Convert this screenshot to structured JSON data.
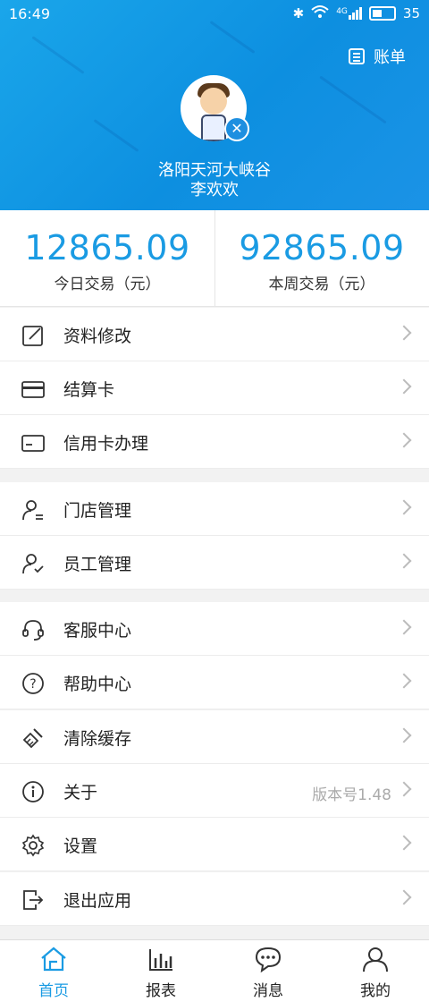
{
  "status_bar": {
    "time": "16:49",
    "network": "4G",
    "battery": "35"
  },
  "header": {
    "bill_label": "账单",
    "store_name": "洛阳天河大峡谷",
    "user_name": "李欢欢"
  },
  "stats": {
    "today": {
      "value": "12865.09",
      "label": "今日交易（元）"
    },
    "week": {
      "value": "92865.09",
      "label": "本周交易（元）"
    }
  },
  "menu": {
    "profile": {
      "label": "资料修改",
      "icon": "edit-icon"
    },
    "settlement_card": {
      "label": "结算卡",
      "icon": "card-icon"
    },
    "credit_card": {
      "label": "信用卡办理",
      "icon": "credit-card-icon"
    },
    "store_manage": {
      "label": "门店管理",
      "icon": "store-user-icon"
    },
    "staff_manage": {
      "label": "员工管理",
      "icon": "staff-user-icon"
    },
    "customer_service": {
      "label": "客服中心",
      "icon": "headset-icon"
    },
    "help": {
      "label": "帮助中心",
      "icon": "question-icon"
    },
    "clear_cache": {
      "label": "清除缓存",
      "icon": "broom-icon"
    },
    "about": {
      "label": "关于",
      "icon": "info-icon",
      "value": "版本号1.48"
    },
    "settings": {
      "label": "设置",
      "icon": "gear-icon"
    },
    "logout": {
      "label": "退出应用",
      "icon": "exit-icon"
    }
  },
  "tabs": {
    "home": {
      "label": "首页",
      "active": true
    },
    "report": {
      "label": "报表"
    },
    "message": {
      "label": "消息"
    },
    "mine": {
      "label": "我的"
    }
  },
  "colors": {
    "accent": "#1a9be3",
    "header_bg": "#1aa6ea"
  }
}
